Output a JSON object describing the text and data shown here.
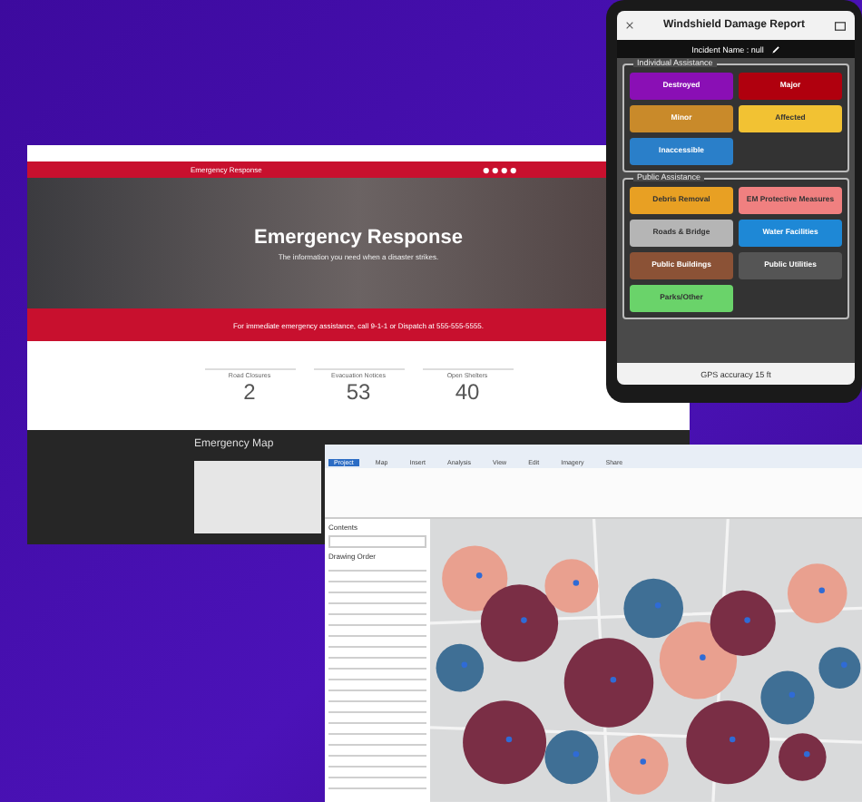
{
  "website": {
    "nav_title": "Emergency Response",
    "hero_title": "Emergency Response",
    "hero_subtitle": "The information you need when a disaster strikes.",
    "banner": "For immediate emergency assistance, call 9-1-1 or Dispatch at 555-555-5555.",
    "stats": [
      {
        "label": "Road Closures",
        "value": "2"
      },
      {
        "label": "Evacuation Notices",
        "value": "53"
      },
      {
        "label": "Open Shelters",
        "value": "40"
      }
    ],
    "map_title": "Emergency Map"
  },
  "phone": {
    "title": "Windshield Damage Report",
    "incident": "Incident Name : null",
    "sections": [
      {
        "title": "Individual Assistance",
        "items": [
          {
            "label": "Destroyed",
            "color": "#8a0fb5"
          },
          {
            "label": "Major",
            "color": "#b0000e"
          },
          {
            "label": "Minor",
            "color": "#c98a2a"
          },
          {
            "label": "Affected",
            "color": "#f2c233"
          },
          {
            "label": "Inaccessible",
            "color": "#2a7fc9"
          }
        ]
      },
      {
        "title": "Public Assistance",
        "items": [
          {
            "label": "Debris Removal",
            "color": "#e8a023"
          },
          {
            "label": "EM Protective Measures",
            "color": "#f08080"
          },
          {
            "label": "Roads & Bridge",
            "color": "#b5b5b5"
          },
          {
            "label": "Water Facilities",
            "color": "#1e88d6"
          },
          {
            "label": "Public Buildings",
            "color": "#8b5236"
          },
          {
            "label": "Public Utilities",
            "color": "#555555"
          },
          {
            "label": "Parks/Other",
            "color": "#6ad36a"
          }
        ]
      }
    ],
    "gps": "GPS accuracy 15 ft"
  },
  "gis": {
    "tabs": [
      {
        "label": "Project",
        "selected": true
      },
      {
        "label": "Map",
        "selected": false
      },
      {
        "label": "Insert",
        "selected": false
      },
      {
        "label": "Analysis",
        "selected": false
      },
      {
        "label": "View",
        "selected": false
      },
      {
        "label": "Edit",
        "selected": false
      },
      {
        "label": "Imagery",
        "selected": false
      },
      {
        "label": "Share",
        "selected": false
      }
    ],
    "contents_title": "Contents",
    "drawing_order": "Drawing Order"
  }
}
